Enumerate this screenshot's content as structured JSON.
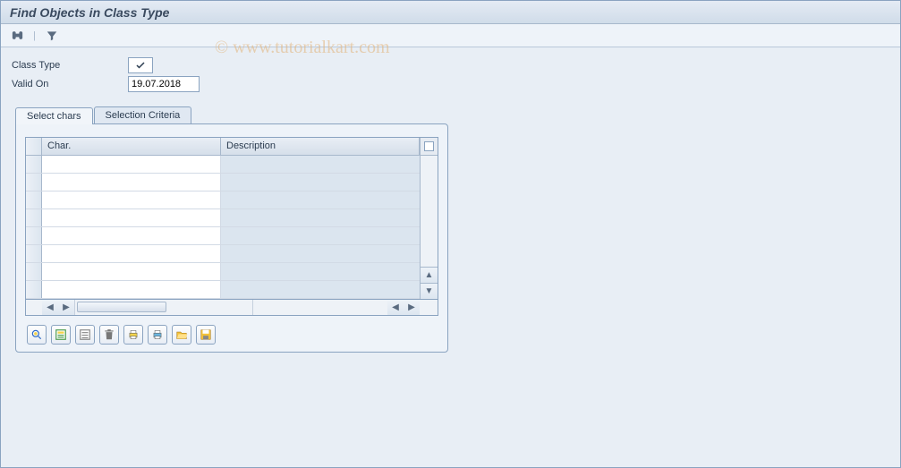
{
  "title": "Find Objects in Class Type",
  "watermark": "© www.tutorialkart.com",
  "toolbar": {
    "binoculars_label": "Find",
    "filter_label": "Filter"
  },
  "form": {
    "class_type_label": "Class Type",
    "class_type_value_icon": "checkmark",
    "valid_on_label": "Valid On",
    "valid_on_value": "19.07.2018"
  },
  "tabs": {
    "select_chars": "Select chars",
    "selection_criteria": "Selection Criteria",
    "active": "select_chars"
  },
  "grid": {
    "columns": {
      "char": "Char.",
      "description": "Description"
    },
    "rows": [
      {
        "char": "",
        "description": ""
      },
      {
        "char": "",
        "description": ""
      },
      {
        "char": "",
        "description": ""
      },
      {
        "char": "",
        "description": ""
      },
      {
        "char": "",
        "description": ""
      },
      {
        "char": "",
        "description": ""
      },
      {
        "char": "",
        "description": ""
      },
      {
        "char": "",
        "description": ""
      }
    ]
  },
  "actions": {
    "find": "find",
    "select_all": "select-all",
    "deselect_all": "deselect-all",
    "delete": "delete",
    "print": "print",
    "filter": "filter",
    "open": "open",
    "save": "save"
  }
}
